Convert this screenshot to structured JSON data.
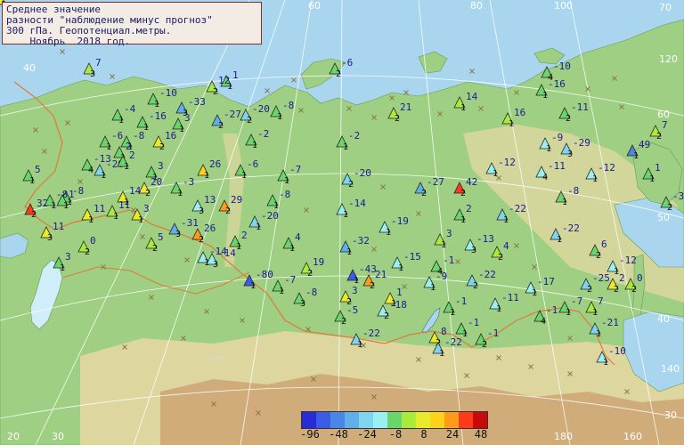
{
  "title": {
    "line1": "Среднее значение",
    "line2": "разности \"наблюдение минус прогноз\"",
    "line3": "300 гПа. Геопотенциал.метры.",
    "line4": "    Ноябрь  2018 год."
  },
  "colors": {
    "sea": "#a9d6ee",
    "land": "#9fcf82",
    "highland": "#e8d8a4",
    "mountain": "#c99a6a",
    "border": "#e07a3a",
    "label": "#1b1b8f",
    "rank": "#111111"
  },
  "graticule_labels": {
    "lon": [
      "20",
      "30",
      "40",
      "50",
      "60",
      "80",
      "100",
      "120",
      "140",
      "160",
      "180"
    ],
    "lat": [
      "70",
      "60",
      "50",
      "40",
      "30"
    ]
  },
  "legend": {
    "colors": [
      "#2a2ad6",
      "#3a5ce6",
      "#4a86e6",
      "#5fb0ea",
      "#7fd4f0",
      "#9af0f0",
      "#6ad66a",
      "#aaea3a",
      "#eaea2a",
      "#ffd21a",
      "#ff9a1a",
      "#ff3a1a",
      "#c80a0a"
    ],
    "labels": [
      "-96",
      "-48",
      "-24",
      "-8",
      "8",
      "24",
      "48"
    ]
  },
  "stations": [
    {
      "value": "7",
      "rank": "3",
      "color": "#aaea3a"
    },
    {
      "value": "-6",
      "rank": "2",
      "color": "#6ad66a"
    },
    {
      "value": "1",
      "rank": "1",
      "color": "#6ad66a"
    },
    {
      "value": "12",
      "rank": "2",
      "color": "#aaea3a"
    },
    {
      "value": "-10",
      "rank": "1",
      "color": "#6ad66a"
    },
    {
      "value": "-33",
      "rank": "3",
      "color": "#5fb0ea"
    },
    {
      "value": "-4",
      "rank": "1",
      "color": "#6ad66a"
    },
    {
      "value": "-16",
      "rank": "1",
      "color": "#6ad66a"
    },
    {
      "value": "-27",
      "rank": "2",
      "color": "#5fb0ea"
    },
    {
      "value": "-20",
      "rank": "2",
      "color": "#7fd4f0"
    },
    {
      "value": "-8",
      "rank": "1",
      "color": "#6ad66a"
    },
    {
      "value": "21",
      "rank": "2",
      "color": "#aaea3a"
    },
    {
      "value": "14",
      "rank": "1",
      "color": "#aaea3a"
    },
    {
      "value": "-10",
      "rank": "4",
      "color": "#6ad66a"
    },
    {
      "value": "-16",
      "rank": "1",
      "color": "#6ad66a"
    },
    {
      "value": "3",
      "rank": "1",
      "color": "#6ad66a"
    },
    {
      "value": "-6",
      "rank": "1",
      "color": "#6ad66a"
    },
    {
      "value": "-8",
      "rank": "1",
      "color": "#6ad66a"
    },
    {
      "value": "16",
      "rank": "2",
      "color": "#eaea2a"
    },
    {
      "value": "-13",
      "rank": "4",
      "color": "#6ad66a"
    },
    {
      "value": "2",
      "rank": "1",
      "color": "#6ad66a"
    },
    {
      "value": "-2",
      "rank": "1",
      "color": "#6ad66a"
    },
    {
      "value": "-2",
      "rank": "1",
      "color": "#6ad66a"
    },
    {
      "value": "16",
      "rank": "1",
      "color": "#aaea3a"
    },
    {
      "value": "-11",
      "rank": "2",
      "color": "#6ad66a"
    },
    {
      "value": "-9",
      "rank": "1",
      "color": "#9af0f0"
    },
    {
      "value": "-29",
      "rank": "3",
      "color": "#7fd4f0"
    },
    {
      "value": "7",
      "rank": "2",
      "color": "#aaea3a"
    },
    {
      "value": "49",
      "rank": "1",
      "color": "#4a86e6"
    },
    {
      "value": "5",
      "rank": "1",
      "color": "#6ad66a"
    },
    {
      "value": "-20",
      "rank": "1",
      "color": "#7fd4f0"
    },
    {
      "value": "2",
      "rank": "1",
      "color": "#6ad66a"
    },
    {
      "value": "3",
      "rank": "1",
      "color": "#6ad66a"
    },
    {
      "value": "26",
      "rank": "1",
      "color": "#ffd21a"
    },
    {
      "value": "-6",
      "rank": "1",
      "color": "#6ad66a"
    },
    {
      "value": "-7",
      "rank": "1",
      "color": "#6ad66a"
    },
    {
      "value": "-20",
      "rank": "2",
      "color": "#7fd4f0"
    },
    {
      "value": "-12",
      "rank": "1",
      "color": "#9af0f0"
    },
    {
      "value": "-11",
      "rank": "4",
      "color": "#9af0f0"
    },
    {
      "value": "-12",
      "rank": "1",
      "color": "#9af0f0"
    },
    {
      "value": "1",
      "rank": "1",
      "color": "#6ad66a"
    },
    {
      "value": "-8",
      "rank": "1",
      "color": "#6ad66a"
    },
    {
      "value": "-3",
      "rank": "2",
      "color": "#6ad66a"
    },
    {
      "value": "-8",
      "rank": "1",
      "color": "#6ad66a"
    },
    {
      "value": "-3",
      "rank": "1",
      "color": "#6ad66a"
    },
    {
      "value": "20",
      "rank": "2",
      "color": "#eaea2a"
    },
    {
      "value": "14",
      "rank": "1",
      "color": "#eaea2a"
    },
    {
      "value": "-27",
      "rank": "2",
      "color": "#5fb0ea"
    },
    {
      "value": "42",
      "rank": "2",
      "color": "#ff3a1a"
    },
    {
      "value": "-8",
      "rank": "1",
      "color": "#6ad66a"
    },
    {
      "value": "32",
      "rank": "2",
      "color": "#ff3a1a"
    },
    {
      "value": "-8",
      "rank": "1",
      "color": "#6ad66a"
    },
    {
      "value": "1",
      "rank": "1",
      "color": "#6ad66a"
    },
    {
      "value": "11",
      "rank": "1",
      "color": "#eaea2a"
    },
    {
      "value": "11",
      "rank": "1",
      "color": "#aaea3a"
    },
    {
      "value": "3",
      "rank": "1",
      "color": "#eaea2a"
    },
    {
      "value": "13",
      "rank": "3",
      "color": "#9af0f0"
    },
    {
      "value": "29",
      "rank": "2",
      "color": "#ff9a1a"
    },
    {
      "value": "-14",
      "rank": "1",
      "color": "#9af0f0"
    },
    {
      "value": "2",
      "rank": "1",
      "color": "#6ad66a"
    },
    {
      "value": "-22",
      "rank": "1",
      "color": "#7fd4f0"
    },
    {
      "value": "11",
      "rank": "3",
      "color": "#eaea2a"
    },
    {
      "value": "-20",
      "rank": "1",
      "color": "#7fd4f0"
    },
    {
      "value": "-19",
      "rank": "1",
      "color": "#9af0f0"
    },
    {
      "value": "-22",
      "rank": "1",
      "color": "#7fd4f0"
    },
    {
      "value": "-31",
      "rank": "3",
      "color": "#5fb0ea"
    },
    {
      "value": "26",
      "rank": "2",
      "color": "#ff9a1a"
    },
    {
      "value": "2",
      "rank": "1",
      "color": "#6ad66a"
    },
    {
      "value": "4",
      "rank": "1",
      "color": "#6ad66a"
    },
    {
      "value": "3",
      "rank": "1",
      "color": "#aaea3a"
    },
    {
      "value": "-13",
      "rank": "3",
      "color": "#9af0f0"
    },
    {
      "value": "4",
      "rank": "2",
      "color": "#aaea3a"
    },
    {
      "value": "6",
      "rank": "2",
      "color": "#6ad66a"
    },
    {
      "value": "-14",
      "rank": "1",
      "color": "#9af0f0"
    },
    {
      "value": "-12",
      "rank": "1",
      "color": "#9af0f0"
    },
    {
      "value": "0",
      "rank": "2",
      "color": "#aaea3a"
    },
    {
      "value": "5",
      "rank": "2",
      "color": "#aaea3a"
    },
    {
      "value": "-14",
      "rank": "3",
      "color": "#9af0f0"
    },
    {
      "value": "-32",
      "rank": "1",
      "color": "#5fb0ea"
    },
    {
      "value": "-15",
      "rank": "1",
      "color": "#9af0f0"
    },
    {
      "value": "-1",
      "rank": "4",
      "color": "#6ad66a"
    },
    {
      "value": "-22",
      "rank": "2",
      "color": "#7fd4f0"
    },
    {
      "value": "-25",
      "rank": "2",
      "color": "#7fd4f0"
    },
    {
      "value": "2",
      "rank": "2",
      "color": "#eaea2a"
    },
    {
      "value": "0",
      "rank": "2",
      "color": "#aaea3a"
    },
    {
      "value": "3",
      "rank": "1",
      "color": "#6ad66a"
    },
    {
      "value": "19",
      "rank": "2",
      "color": "#aaea3a"
    },
    {
      "value": "-43",
      "rank": "1",
      "color": "#3a5ce6"
    },
    {
      "value": "21",
      "rank": "2",
      "color": "#ff9a1a"
    },
    {
      "value": "-9",
      "rank": "1",
      "color": "#9af0f0"
    },
    {
      "value": "-17",
      "rank": "1",
      "color": "#9af0f0"
    },
    {
      "value": "-80",
      "rank": "1",
      "color": "#3a5ce6"
    },
    {
      "value": "-7",
      "rank": "1",
      "color": "#6ad66a"
    },
    {
      "value": "-8",
      "rank": "3",
      "color": "#6ad66a"
    },
    {
      "value": "3",
      "rank": "2",
      "color": "#eaea2a"
    },
    {
      "value": "1",
      "rank": "1",
      "color": "#eaea2a"
    },
    {
      "value": "-11",
      "rank": "1",
      "color": "#9af0f0"
    },
    {
      "value": "-1",
      "rank": "4",
      "color": "#6ad66a"
    },
    {
      "value": "-7",
      "rank": "1",
      "color": "#6ad66a"
    },
    {
      "value": "7",
      "rank": "1",
      "color": "#aaea3a"
    },
    {
      "value": "-1",
      "rank": "1",
      "color": "#6ad66a"
    },
    {
      "value": "-5",
      "rank": "2",
      "color": "#6ad66a"
    },
    {
      "value": "-18",
      "rank": "2",
      "color": "#9af0f0"
    },
    {
      "value": "8",
      "rank": "2",
      "color": "#eaea2a"
    },
    {
      "value": "-1",
      "rank": "1",
      "color": "#6ad66a"
    },
    {
      "value": "-21",
      "rank": "1",
      "color": "#7fd4f0"
    },
    {
      "value": "-22",
      "rank": "1",
      "color": "#7fd4f0"
    },
    {
      "value": "-1",
      "rank": "2",
      "color": "#6ad66a"
    },
    {
      "value": "-22",
      "rank": "1",
      "color": "#7fd4f0"
    },
    {
      "value": "-10",
      "rank": "1",
      "color": "#9af0f0"
    },
    {
      "value": "7",
      "rank": "2",
      "color": "#aaea3a"
    },
    {
      "value": "13",
      "rank": "1",
      "color": "#eaea2a"
    }
  ]
}
